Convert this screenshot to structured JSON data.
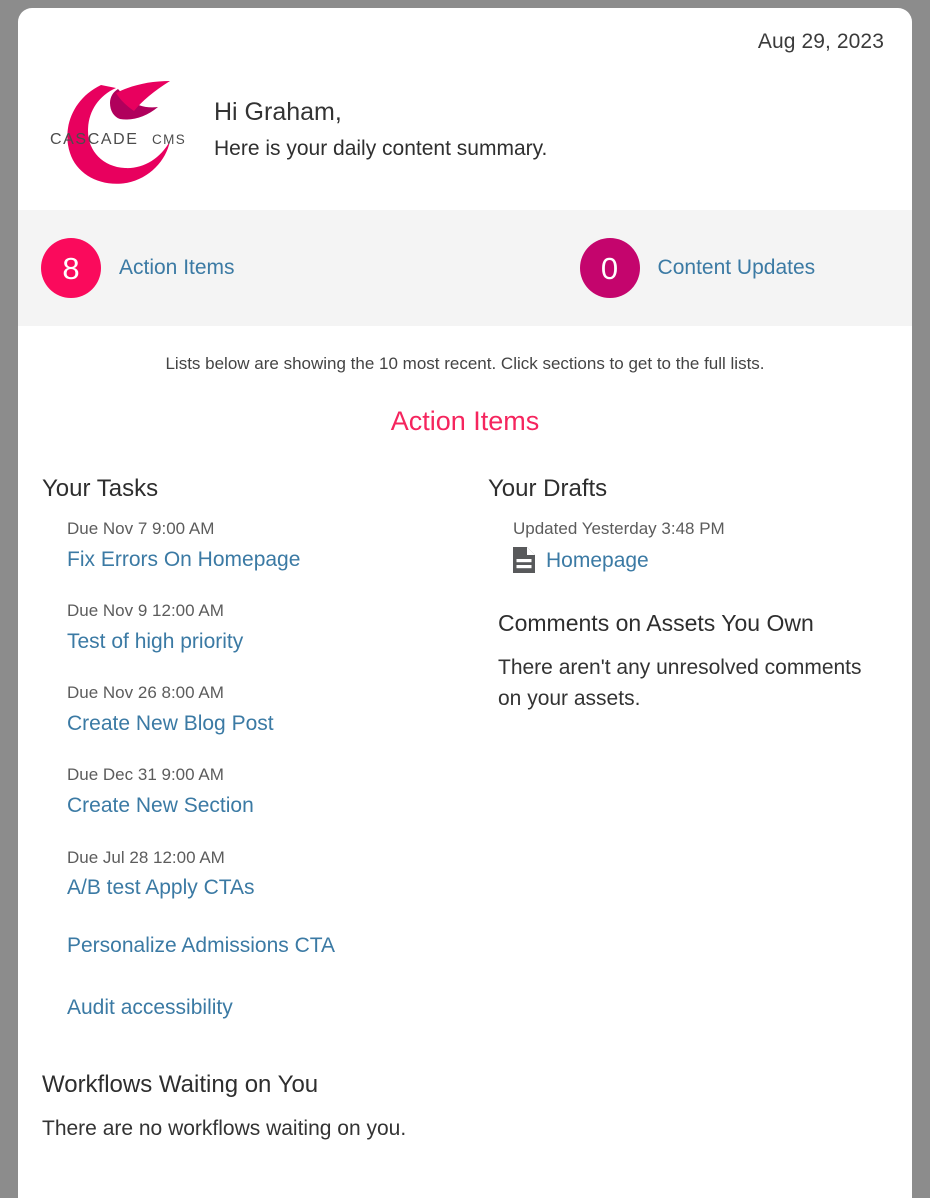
{
  "colors": {
    "accent_pink": "#f5255e",
    "badge_bright": "#fa0a5c",
    "badge_dark": "#c4056d",
    "link_blue": "#3b7aa4",
    "page_bg": "#8c8c8c",
    "stats_bar_bg": "#f4f4f4",
    "doc_icon_gray": "#58595b"
  },
  "header": {
    "date": "Aug 29, 2023",
    "logo_name": "cascade-cms-logo",
    "logo_wordmark": "CASCADE CMS",
    "greeting": "Hi Graham,",
    "subtitle": "Here is your daily content summary."
  },
  "stats": [
    {
      "count": "8",
      "label": "Action Items",
      "badge_color": "#fa0a5c"
    },
    {
      "count": "0",
      "label": "Content Updates",
      "badge_color": "#c4056d"
    }
  ],
  "note": "Lists below are showing the 10 most recent. Click sections to get to the full lists.",
  "section_title": "Action Items",
  "your_tasks": {
    "heading": "Your Tasks",
    "items": [
      {
        "meta": "Due Nov 7 9:00 AM",
        "title": "Fix Errors On Homepage"
      },
      {
        "meta": "Due Nov 9 12:00 AM",
        "title": "Test of high priority"
      },
      {
        "meta": "Due Nov 26 8:00 AM",
        "title": "Create New Blog Post"
      },
      {
        "meta": "Due Dec 31 9:00 AM",
        "title": "Create New Section"
      },
      {
        "meta": "Due Jul 28 12:00 AM",
        "title": "A/B test Apply CTAs"
      },
      {
        "meta": "",
        "title": "Personalize Admissions CTA"
      },
      {
        "meta": "",
        "title": "Audit accessibility"
      }
    ]
  },
  "your_drafts": {
    "heading": "Your Drafts",
    "items": [
      {
        "meta": "Updated Yesterday 3:48 PM",
        "title": "Homepage",
        "icon": "document-icon"
      }
    ]
  },
  "comments": {
    "heading": "Comments on Assets You Own",
    "empty_text": "There aren't any unresolved comments on your assets."
  },
  "workflows": {
    "heading": "Workflows Waiting on You",
    "empty_text": "There are no workflows waiting on you."
  }
}
